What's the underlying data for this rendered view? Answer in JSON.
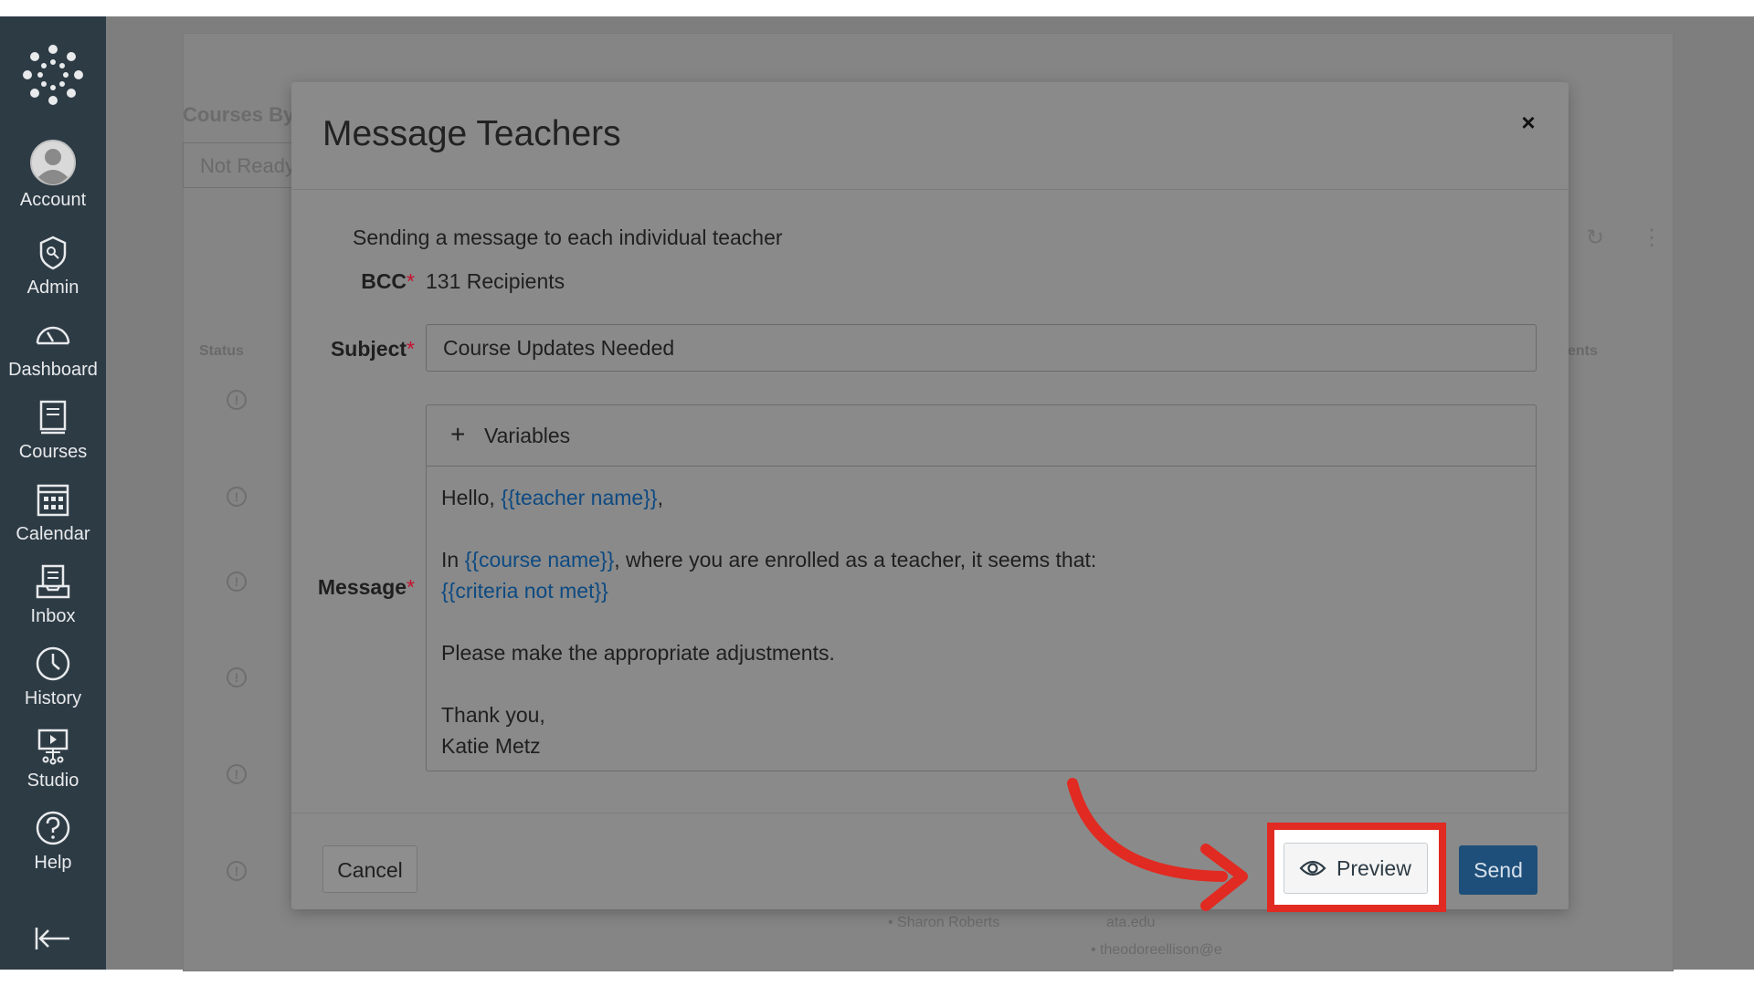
{
  "nav": {
    "items": [
      {
        "label": "Account",
        "icon": "account-icon"
      },
      {
        "label": "Admin",
        "icon": "admin-icon"
      },
      {
        "label": "Dashboard",
        "icon": "dashboard-icon"
      },
      {
        "label": "Courses",
        "icon": "courses-icon"
      },
      {
        "label": "Calendar",
        "icon": "calendar-icon"
      },
      {
        "label": "Inbox",
        "icon": "inbox-icon"
      },
      {
        "label": "History",
        "icon": "history-icon"
      },
      {
        "label": "Studio",
        "icon": "studio-icon"
      },
      {
        "label": "Help",
        "icon": "help-icon"
      }
    ]
  },
  "background": {
    "title": "Courses By",
    "select_value": "Not Ready",
    "status_header": "Status",
    "right_header": "ents",
    "list_items": [
      "Sharon Roberts",
      "ata.edu",
      "theodoreellison@e"
    ]
  },
  "modal": {
    "title": "Message Teachers",
    "close_label": "×",
    "intro": "Sending a message to each individual teacher",
    "bcc_label": "BCC",
    "bcc_value": "131 Recipients",
    "subject_label": "Subject",
    "subject_value": "Course Updates Needed",
    "message_label": "Message",
    "required_mark": "*",
    "variables_label": "Variables",
    "body": {
      "greeting_prefix": "Hello, ",
      "greeting_var": "{{teacher name}}",
      "greeting_suffix": ",",
      "line2_prefix": "In ",
      "line2_var": "{{course name}}",
      "line2_suffix": ", where you are enrolled as a teacher, it seems that:",
      "line3_var": "{{criteria not met}}",
      "line4": "Please make the appropriate adjustments.",
      "line5": "Thank you,",
      "line6": "Katie Metz"
    },
    "cancel_label": "Cancel",
    "preview_label": "Preview",
    "send_label": "Send"
  },
  "colors": {
    "nav_bg": "#2d3b45",
    "highlight": "#e12a21",
    "send_bg": "#1e4f7a",
    "variable_text": "#0d4a82"
  }
}
